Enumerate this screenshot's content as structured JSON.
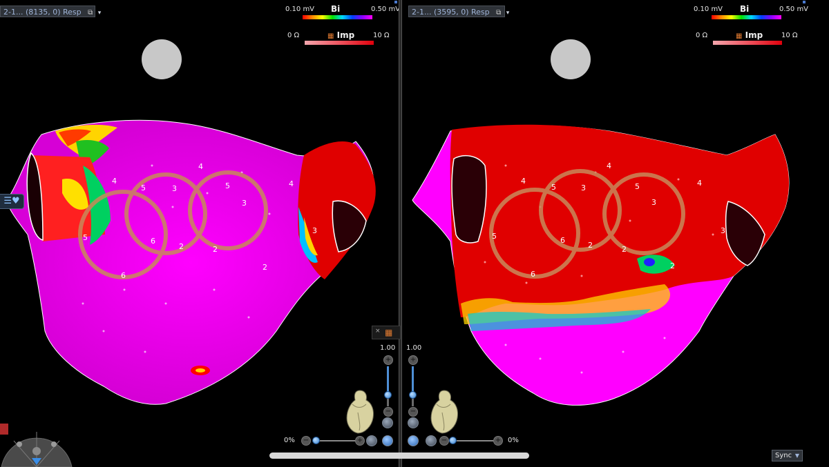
{
  "left_view": {
    "title": "2-1... (8135, 0) Resp",
    "bi_legend": {
      "min": "0.10 mV",
      "label": "Bi",
      "max": "0.50 mV"
    },
    "imp_legend": {
      "min": "0 Ω",
      "label": "Imp",
      "max": "10 Ω"
    },
    "electrode_labels": [
      "4",
      "5",
      "3",
      "4",
      "3",
      "5",
      "5",
      "6",
      "2",
      "2",
      "2",
      "3",
      "6",
      "1",
      "3",
      "4"
    ]
  },
  "right_view": {
    "title": "2-1... (3595, 0) Resp",
    "bi_legend": {
      "min": "0.10 mV",
      "label": "Bi",
      "max": "0.50 mV"
    },
    "imp_legend": {
      "min": "0 Ω",
      "label": "Imp",
      "max": "10 Ω"
    },
    "electrode_labels": [
      "4",
      "5",
      "3",
      "4",
      "3",
      "5",
      "5",
      "6",
      "2",
      "2",
      "2",
      "3",
      "6",
      "1",
      "4"
    ]
  },
  "controls": {
    "left_scale": "1.00",
    "right_scale": "1.00",
    "left_percent": "0%",
    "right_percent": "0%",
    "close_glyph": "×"
  },
  "sync": {
    "label": "Sync"
  },
  "icons": {
    "view_caret": "chevron-down-icon",
    "heart_model": "heart-model-icon",
    "orientation": "orientation-widget-icon"
  },
  "colors": {
    "background": "#000000",
    "magenta": "#ff00ff",
    "red": "#e00000",
    "catheter": "#c8895a",
    "panel": "#2e3238",
    "accent": "#4e8fd6"
  }
}
